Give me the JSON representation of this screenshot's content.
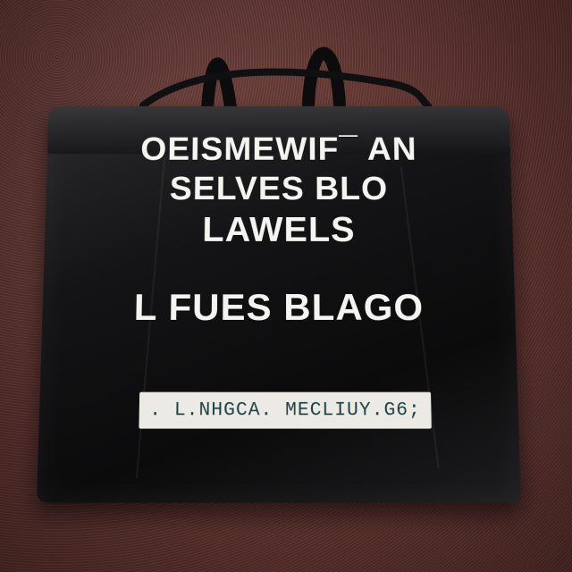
{
  "bag": {
    "line1": "OEISMEWIF¯ AN",
    "line2": "SELVES BLO",
    "line3": "LAWELS",
    "line4": "L FUES BLAGO",
    "label_strip": ". L.NHGCA. MECLIUY.G6;"
  },
  "colors": {
    "bag": "#111113",
    "print": "#f4f4f0",
    "label_strip": "#eceae4",
    "label_text": "#1d3f44",
    "floor": "#5d332f"
  }
}
